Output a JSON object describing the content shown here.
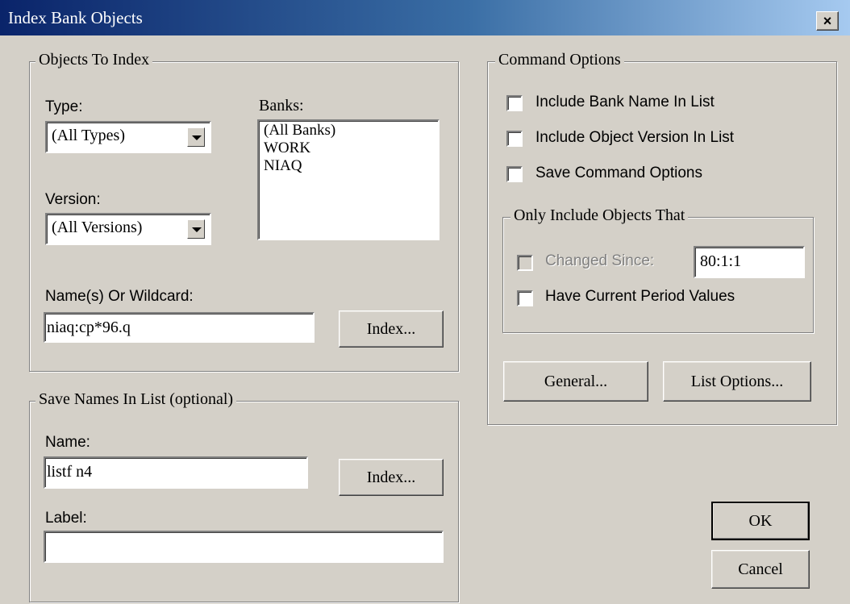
{
  "window": {
    "title": "Index Bank Objects",
    "close_label": "×"
  },
  "objects_group": {
    "legend": "Objects To Index",
    "type_label": "Type:",
    "type_value": "(All Types)",
    "version_label": "Version:",
    "version_value": "(All Versions)",
    "banks_label": "Banks:",
    "banks": [
      "(All Banks)",
      "WORK",
      "NIAQ"
    ],
    "name_label": "Name(s) Or Wildcard:",
    "name_value": "niaq:cp*96.q",
    "index_button": "Index..."
  },
  "save_group": {
    "legend": "Save Names In List (optional)",
    "name_label": "Name:",
    "name_value": "listf n4",
    "index_button": "Index...",
    "label_label": "Label:",
    "label_value": ""
  },
  "command_options": {
    "legend": "Command Options",
    "include_bank_name": "Include Bank Name In List",
    "include_object_version": "Include Object Version In List",
    "save_command_options": "Save Command Options",
    "only_group": {
      "legend": "Only Include Objects That",
      "changed_since_label": "Changed Since:",
      "changed_since_value": "80:1:1",
      "have_current_period": "Have Current Period Values"
    },
    "general_button": "General...",
    "list_options_button": "List Options..."
  },
  "buttons": {
    "ok": "OK",
    "cancel": "Cancel"
  }
}
